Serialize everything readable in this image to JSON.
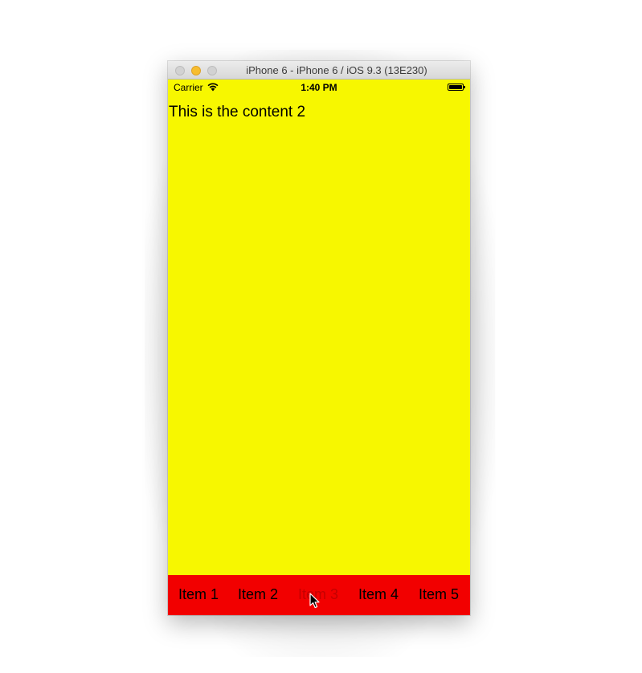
{
  "window": {
    "title": "iPhone 6 - iPhone 6 / iOS 9.3 (13E230)"
  },
  "status_bar": {
    "carrier": "Carrier",
    "wifi_icon": "wifi-icon",
    "time": "1:40 PM",
    "battery_icon": "battery-icon"
  },
  "content": {
    "text": "This is the content 2",
    "background": "#f7f700"
  },
  "tab_bar": {
    "background": "#f20000",
    "active_index": 2,
    "items": [
      {
        "label": "Item 1"
      },
      {
        "label": "Item 2"
      },
      {
        "label": "Item 3"
      },
      {
        "label": "Item 4"
      },
      {
        "label": "Item 5"
      }
    ]
  },
  "cursor_icon": "arrow-cursor-icon"
}
